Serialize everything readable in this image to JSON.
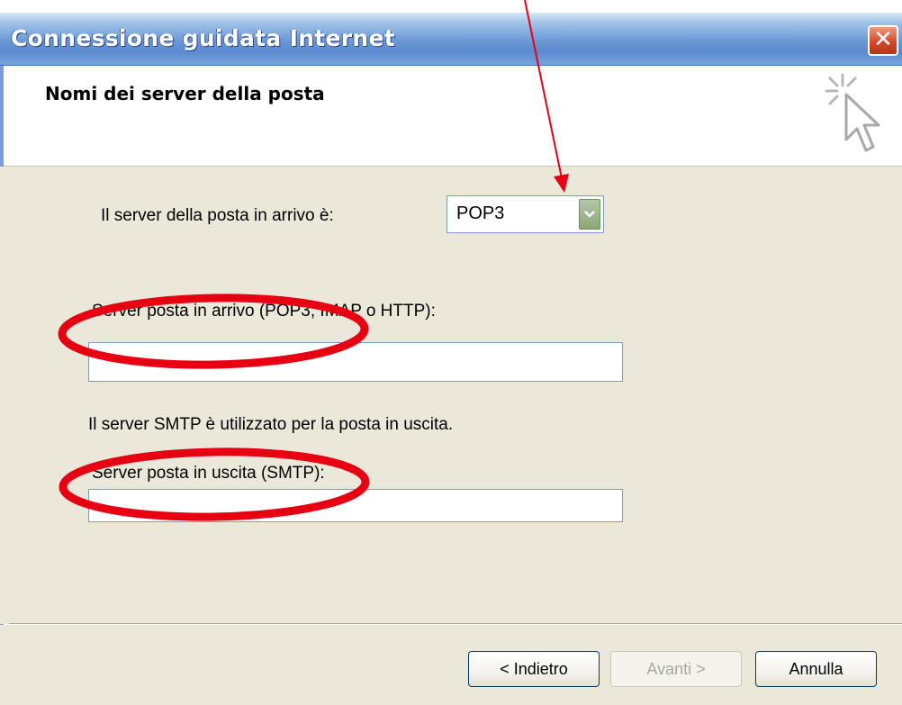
{
  "window": {
    "title": "Connessione guidata Internet",
    "close_label": "✕"
  },
  "header": {
    "title": "Nomi dei server della posta",
    "icon": "wizard-cursor-icon"
  },
  "form": {
    "incoming_type_label": "Il server della posta in arrivo è:",
    "incoming_type_value": "POP3",
    "incoming_server_label": "Server posta in arrivo (POP3, IMAP o HTTP):",
    "incoming_server_value": "",
    "smtp_note": "Il server SMTP è utilizzato per la posta in uscita.",
    "outgoing_server_label": "Server posta in uscita (SMTP):",
    "outgoing_server_value": ""
  },
  "buttons": {
    "back": "< Indietro",
    "next": "Avanti >",
    "cancel": "Annulla"
  },
  "colors": {
    "annotation": "#e60012",
    "titlebar": "#6a98d6",
    "dialog_bg": "#ebe8da"
  }
}
